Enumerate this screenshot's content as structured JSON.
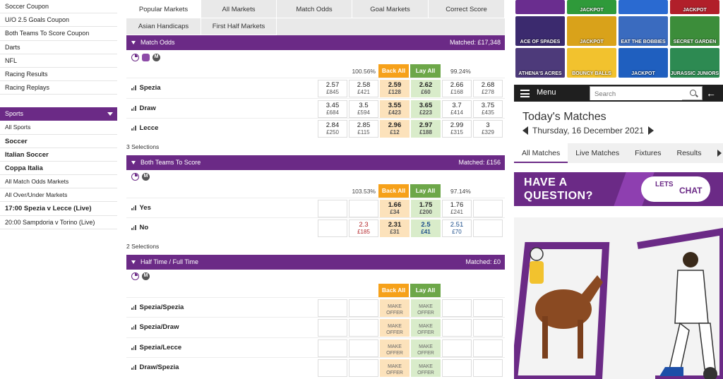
{
  "sidebar": {
    "top_items": [
      "Soccer Coupon",
      "U/O 2.5 Goals Coupon",
      "Both Teams To Score Coupon",
      "Darts",
      "NFL",
      "Racing Results",
      "Racing Replays"
    ],
    "sports_header": "Sports",
    "sports_items": [
      {
        "label": "All Sports",
        "style": "sub"
      },
      {
        "label": "Soccer",
        "style": "bold"
      },
      {
        "label": "Italian Soccer",
        "style": "bold"
      },
      {
        "label": "Coppa Italia",
        "style": "bold"
      },
      {
        "label": "All Match Odds Markets",
        "style": "sub"
      },
      {
        "label": "All Over/Under Markets",
        "style": "sub"
      },
      {
        "label": "17:00 Spezia v Lecce (Live)",
        "style": "bold"
      },
      {
        "label": "20:00 Sampdoria v Torino (Live)",
        "style": "normal"
      }
    ]
  },
  "tabs": {
    "row1": [
      "Popular Markets",
      "All Markets",
      "Match Odds",
      "Goal Markets",
      "Correct Score"
    ],
    "row2": [
      "Asian Handicaps",
      "First Half Markets"
    ]
  },
  "markets": {
    "match_odds": {
      "title": "Match Odds",
      "matched": "Matched: £17,348",
      "pct_left": "100.56%",
      "pct_right": "99.24%",
      "back_all": "Back All",
      "lay_all": "Lay All",
      "selections": "3 Selections",
      "runners": [
        {
          "name": "Spezia",
          "prices": [
            [
              "2.57",
              "£845"
            ],
            [
              "2.58",
              "£421"
            ],
            [
              "2.59",
              "£128"
            ],
            [
              "2.62",
              "£60"
            ],
            [
              "2.66",
              "£168"
            ],
            [
              "2.68",
              "£278"
            ]
          ]
        },
        {
          "name": "Draw",
          "prices": [
            [
              "3.45",
              "£684"
            ],
            [
              "3.5",
              "£594"
            ],
            [
              "3.55",
              "£423"
            ],
            [
              "3.65",
              "£223"
            ],
            [
              "3.7",
              "£414"
            ],
            [
              "3.75",
              "£435"
            ]
          ]
        },
        {
          "name": "Lecce",
          "prices": [
            [
              "2.84",
              "£250"
            ],
            [
              "2.85",
              "£115"
            ],
            [
              "2.96",
              "£12"
            ],
            [
              "2.97",
              "£188"
            ],
            [
              "2.99",
              "£315"
            ],
            [
              "3",
              "£329"
            ]
          ]
        }
      ]
    },
    "btts": {
      "title": "Both Teams To Score",
      "matched": "Matched: £156",
      "pct_left": "103.53%",
      "pct_right": "97.14%",
      "back_all": "Back All",
      "lay_all": "Lay All",
      "selections": "2 Selections",
      "runners": [
        {
          "name": "Yes",
          "prices": [
            [
              "",
              ""
            ],
            [
              "",
              ""
            ],
            [
              "1.66",
              "£34"
            ],
            [
              "1.75",
              "£200"
            ],
            [
              "1.76",
              "£241"
            ],
            [
              "",
              ""
            ]
          ]
        },
        {
          "name": "No",
          "prices": [
            [
              "",
              ""
            ],
            [
              "2.3",
              "£185"
            ],
            [
              "2.31",
              "£31"
            ],
            [
              "2.5",
              "£41"
            ],
            [
              "2.51",
              "£70"
            ],
            [
              "",
              ""
            ]
          ]
        }
      ]
    },
    "htft": {
      "title": "Half Time / Full Time",
      "matched": "Matched: £0",
      "back_all": "Back All",
      "lay_all": "Lay All",
      "make_offer": "MAKE OFFER",
      "runners": [
        "Spezia/Spezia",
        "Spezia/Draw",
        "Spezia/Lecce",
        "Draw/Spezia"
      ]
    }
  },
  "right": {
    "games": [
      {
        "label": "",
        "color": "#6a2d8f"
      },
      {
        "label": "JACKPOT",
        "color": "#2f9a3a"
      },
      {
        "label": "",
        "color": "#2a6ad1"
      },
      {
        "label": "JACKPOT",
        "color": "#b11f2a"
      },
      {
        "label": "ACE OF SPADES",
        "color": "#3b2a6e"
      },
      {
        "label": "JACKPOT",
        "color": "#d9a21a"
      },
      {
        "label": "EAT THE BOBBIES",
        "color": "#3a6bbf"
      },
      {
        "label": "SECRET GARDEN",
        "color": "#3c8d3a"
      },
      {
        "label": "ATHENA'S ACRES",
        "color": "#4d3a7a"
      },
      {
        "label": "BOUNCY BALLS",
        "color": "#f2c22e"
      },
      {
        "label": "JACKPOT",
        "color": "#1f5fbf"
      },
      {
        "label": "JURASSIC JUNIORS",
        "color": "#2d8a52"
      }
    ],
    "menu_label": "Menu",
    "search_placeholder": "Search",
    "today_title": "Today's Matches",
    "date": "Thursday, 16 December 2021",
    "tabs": [
      "All Matches",
      "Live Matches",
      "Fixtures",
      "Results"
    ],
    "question_line1": "HAVE A",
    "question_line2": "QUESTION?",
    "chat_line1": "LETS",
    "chat_line2": "CHAT",
    "accent": "#6b2a86",
    "back_color": "#f6a11a",
    "lay_color": "#6da749"
  }
}
